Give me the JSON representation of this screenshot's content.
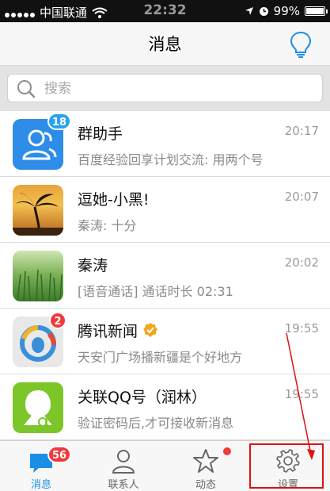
{
  "status_bar": {
    "carrier": "中国联通",
    "time": "22:32",
    "battery": "99%",
    "battery_level": 0.99
  },
  "header": {
    "title": "消息",
    "bulb_icon": "lightbulb-icon"
  },
  "search": {
    "placeholder": "搜索"
  },
  "conversations": [
    {
      "name": "群助手",
      "message": "百度经验回享计划交流: 用两个号",
      "time": "20:17",
      "badge": "18",
      "avatar": "group-assistant-icon"
    },
    {
      "name": "逗她-小黑!",
      "message": "秦涛: 十分",
      "time": "20:07",
      "badge": "",
      "avatar": "palm-sunset-photo"
    },
    {
      "name": "秦涛",
      "message": "[语音通话] 通话时长 02:31",
      "time": "20:02",
      "badge": "",
      "avatar": "grass-photo"
    },
    {
      "name": "腾讯新闻",
      "message": "天安门广场播新疆是个好地方",
      "time": "19:55",
      "badge": "2",
      "avatar": "tencent-news-logo",
      "verified": true
    },
    {
      "name": "关联QQ号（润林）",
      "message": "验证密码后,才可接收新消息",
      "time": "19:55",
      "badge": "",
      "avatar": "qq-user-icon"
    }
  ],
  "tabbar": {
    "messages": {
      "label": "消息",
      "badge": "56"
    },
    "contacts": {
      "label": "联系人"
    },
    "activity": {
      "label": "动态"
    },
    "settings": {
      "label": "设置"
    }
  },
  "colors": {
    "accent": "#1a8ee6",
    "badge": "#f03a3a",
    "annotation": "#dd1111"
  }
}
